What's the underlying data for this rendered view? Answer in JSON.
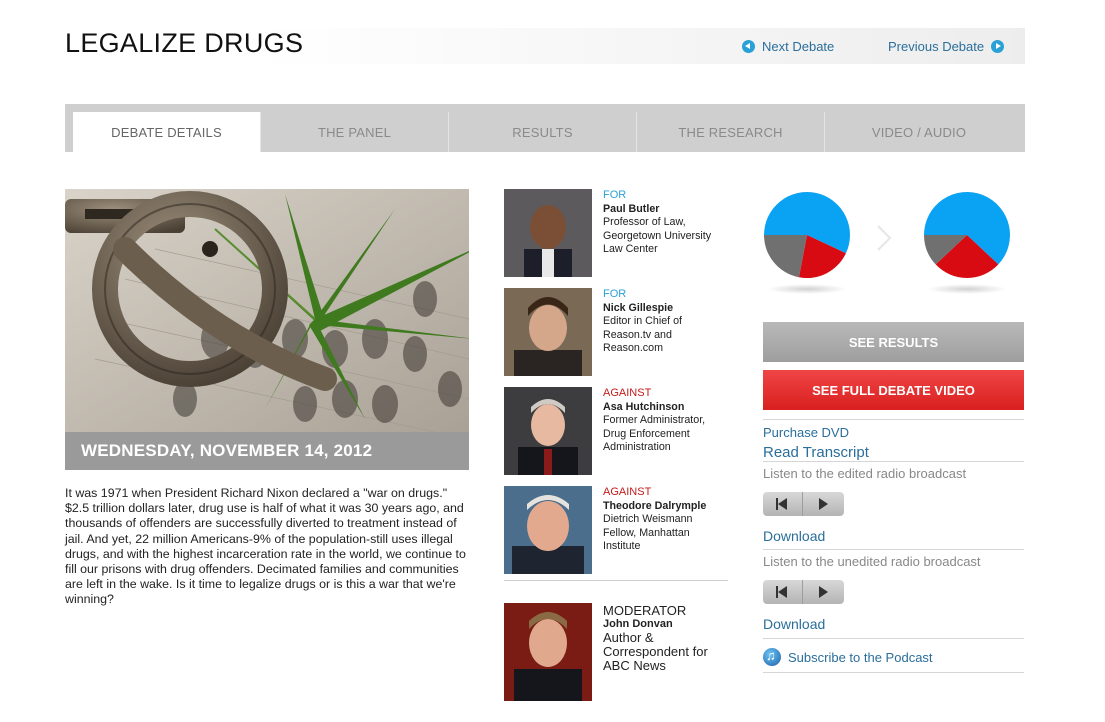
{
  "header": {
    "title": "LEGALIZE DRUGS",
    "next_label": "Next Debate",
    "prev_label": "Previous Debate"
  },
  "tabs": [
    {
      "label": "DEBATE DETAILS",
      "active": true
    },
    {
      "label": "THE PANEL"
    },
    {
      "label": "RESULTS"
    },
    {
      "label": "THE RESEARCH"
    },
    {
      "label": "VIDEO / AUDIO"
    }
  ],
  "debate": {
    "date": "WEDNESDAY, NOVEMBER 14, 2012",
    "description": "It was 1971 when President Richard Nixon declared a \"war on drugs.\" $2.5 trillion dollars later, drug use is half of what it was 30 years ago, and thousands of offenders are successfully diverted to treatment instead of jail. And yet, 22 million Americans-9% of the population-still uses illegal drugs, and with the highest incarceration rate in the world, we continue to fill our prisons with drug offenders. Decimated families and communities are left in the wake. Is it time to legalize drugs or is this a war that we're winning?"
  },
  "panel": [
    {
      "side": "FOR",
      "name": "Paul Butler",
      "role": [
        "Professor of Law,",
        "Georgetown University",
        "Law Center"
      ]
    },
    {
      "side": "FOR",
      "name": "Nick Gillespie",
      "role": [
        "Editor in Chief of",
        "Reason.tv and",
        "Reason.com"
      ]
    },
    {
      "side": "AGAINST",
      "name": "Asa Hutchinson",
      "role": [
        "Former Administrator,",
        "Drug Enforcement",
        "Administration"
      ]
    },
    {
      "side": "AGAINST",
      "name": "Theodore Dalrymple",
      "role": [
        "Dietrich Weismann",
        "Fellow, Manhattan",
        "Institute"
      ]
    }
  ],
  "moderator": {
    "label": "MODERATOR",
    "name": "John Donvan",
    "role": [
      "Author &",
      "Correspondent for",
      "ABC News"
    ]
  },
  "results": {
    "colors": {
      "for": "#0aa2f2",
      "against": "#d80a12",
      "undecided": "#707070"
    },
    "before": {
      "for": 0.57,
      "against": 0.21,
      "undecided": 0.22
    },
    "after": {
      "for": 0.62,
      "against": 0.26,
      "undecided": 0.12
    }
  },
  "actions": {
    "see_results": "SEE RESULTS",
    "see_video": "SEE FULL DEBATE VIDEO",
    "purchase_dvd": "Purchase DVD",
    "read_transcript": "Read Transcript",
    "edited_broadcast": "Listen to the edited radio broadcast",
    "unedited_broadcast": "Listen to the unedited radio broadcast",
    "download": "Download",
    "subscribe": "Subscribe to the Podcast"
  }
}
